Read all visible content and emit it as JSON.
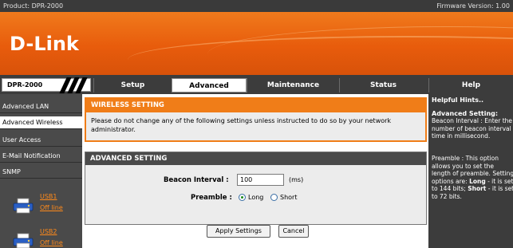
{
  "topbar": {
    "product": "Product: DPR-2000",
    "firmware": "Firmware Version: 1.00"
  },
  "brand": {
    "logo": "D-Link"
  },
  "nav": {
    "model": "DPR-2000",
    "tabs": [
      {
        "label": "Setup",
        "active": false
      },
      {
        "label": "Advanced",
        "active": true
      },
      {
        "label": "Maintenance",
        "active": false
      },
      {
        "label": "Status",
        "active": false
      },
      {
        "label": "Help",
        "active": false
      }
    ]
  },
  "sidebar": {
    "items": [
      {
        "label": "Advanced LAN",
        "active": false
      },
      {
        "label": "Advanced Wireless",
        "active": true
      },
      {
        "label": "User Access",
        "active": false
      },
      {
        "label": "E-Mail Notification",
        "active": false
      },
      {
        "label": "SNMP",
        "active": false
      }
    ],
    "usb": [
      {
        "label": "USB1",
        "status": "Off line"
      },
      {
        "label": "USB2",
        "status": "Off line"
      }
    ]
  },
  "wireless_setting": {
    "title": "WIRELESS SETTING",
    "text": "Please do not change any of the following settings unless instructed to do so by your network administrator."
  },
  "advanced_setting": {
    "title": "ADVANCED SETTING",
    "beacon_label": "Beacon Interval :",
    "beacon_value": "100",
    "beacon_unit": "(ms)",
    "preamble_label": "Preamble :",
    "preamble_options": [
      "Long",
      "Short"
    ],
    "preamble_selected": "Long"
  },
  "buttons": {
    "apply": "Apply Settings",
    "cancel": "Cancel"
  },
  "hints": {
    "title": "Helpful Hints..",
    "subtitle": "Advanced Setting:",
    "beacon": "Beacon Interval : Enter the number of beacon interval time in millisecond.",
    "preamble_a": "Preamble : This option allows you to set the length of preamble. Setting options are: ",
    "preamble_long_word": "Long",
    "preamble_b": " - it is set to 144 bits; ",
    "preamble_short_word": "Short",
    "preamble_c": " - it is set to 72 bits."
  },
  "colors": {
    "orange": "#f07d18",
    "dark_gray": "#3c3c3c",
    "link_orange": "#ff8a1a"
  }
}
